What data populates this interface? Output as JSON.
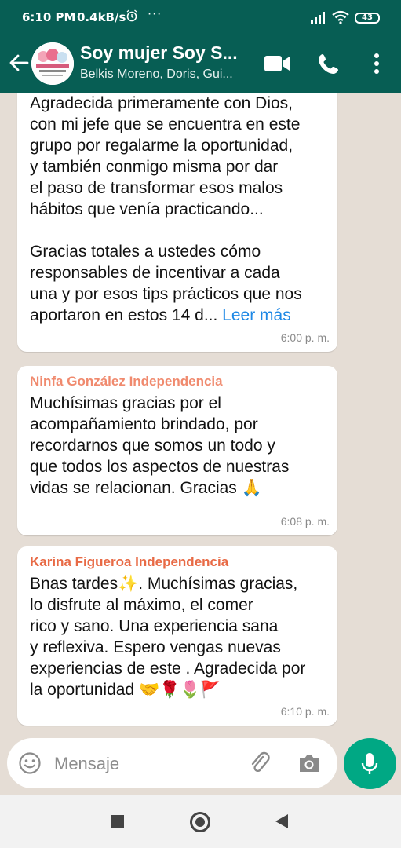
{
  "status_bar": {
    "time": "6:10 PM",
    "network_speed": "0.4kB/s",
    "extra_indicator": "···",
    "battery": "43"
  },
  "header": {
    "title": "Soy mujer Soy S...",
    "subtitle": "Belkis Moreno, Doris, Gui...",
    "accent_color": "#075e54"
  },
  "messages": [
    {
      "sender": "",
      "text": "Agradecida primeramente con Dios,\ncon mi jefe que se encuentra en este\ngrupo por regalarme la oportunidad,\ny también  conmigo misma por dar\nel paso de transformar esos malos\nhábitos que venía practicando...\n\nGracias totales a ustedes cómo\nresponsables de incentivar a cada\nuna y por esos tips prácticos que nos\naportaron en estos 14 d... ",
      "read_more": "Leer más",
      "time": "6:00 p. m."
    },
    {
      "sender": "Ninfa González Independencia",
      "sender_color": "#f08a6e",
      "text": "Muchísimas gracias por el\nacompañamiento brindado, por\nrecordarnos que somos un todo y\nque todos los aspectos de nuestras\nvidas se relacionan. Gracias 🙏",
      "time": "6:08 p. m."
    },
    {
      "sender": "Karina Figueroa Independencia",
      "sender_color": "#e86a45",
      "text": "Bnas tardes✨. Muchísimas gracias,\nlo disfrute al máximo, el comer\nrico y sano. Una experiencia sana\ny reflexiva. Espero vengas nuevas\nexperiencias de este . Agradecida por\nla oportunidad 🤝🌹🌷🚩",
      "time": "6:10 p. m."
    }
  ],
  "input": {
    "placeholder": "Mensaje"
  },
  "icons": {
    "back": "arrow-left-icon",
    "video": "video-call-icon",
    "phone": "phone-icon",
    "menu": "more-vert-icon",
    "emoji": "emoji-icon",
    "attach": "paperclip-icon",
    "camera": "camera-icon",
    "mic": "mic-icon"
  }
}
